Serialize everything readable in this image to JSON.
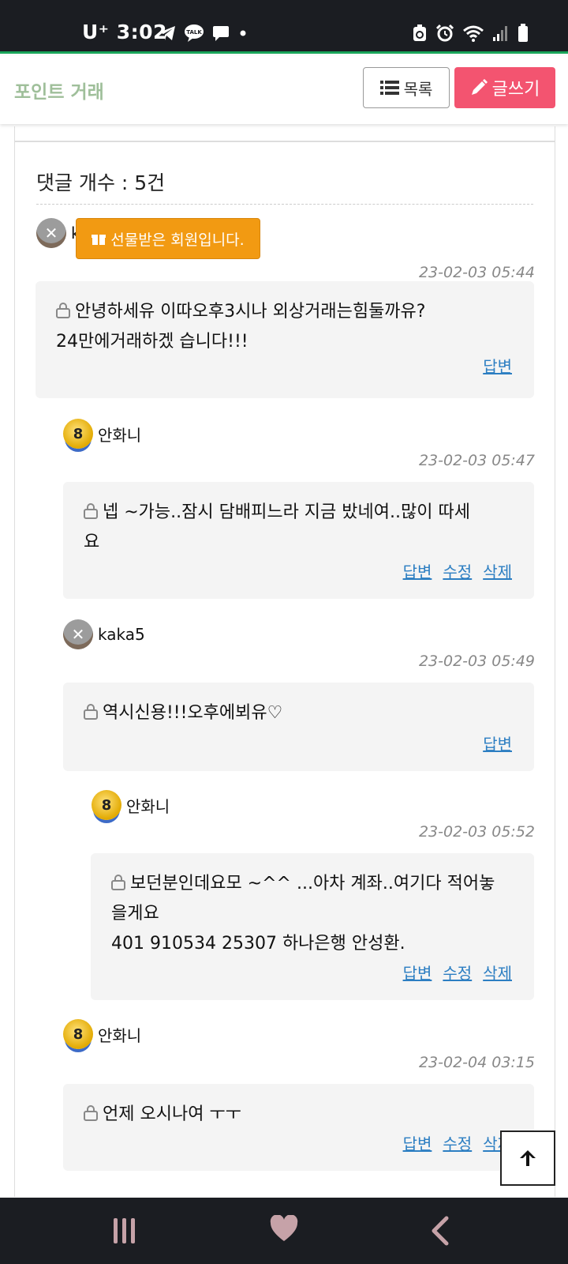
{
  "status_bar": {
    "time": "3:02",
    "carrier": "U⁺",
    "left_icons": [
      "telegram-icon",
      "kakaotalk-icon",
      "message-icon",
      "dot-icon"
    ],
    "right_icons": [
      "recycle-icon",
      "alarm-icon",
      "wifi-icon",
      "signal-icon",
      "battery-icon"
    ]
  },
  "header": {
    "title": "포인트 거래",
    "list_button": "목록",
    "write_button": "글쓰기"
  },
  "comment_count_label": "댓글 개수 : 5건",
  "gift_badge": "선물받은 회원입니다.",
  "comments": [
    {
      "author": "kaka5",
      "avatar": "skull-icon",
      "date": "23-02-03 05:44",
      "lines": [
        "안녕하세유 이따오후3시나 외상거래는힘둘까유?",
        "24만에거래하겠 습니다!!!"
      ],
      "actions": [
        "답변"
      ]
    },
    {
      "author": "안화니",
      "avatar": "medal-8-icon",
      "date": "23-02-03 05:47",
      "lines": [
        "넵  ~가능..잠시 담배피느라 지금 밨네여..많이 따세",
        "요"
      ],
      "actions": [
        "답변",
        "수정",
        "삭제"
      ]
    },
    {
      "author": "kaka5",
      "avatar": "skull-icon",
      "date": "23-02-03 05:49",
      "lines": [
        "역시신용!!!오후에뵈유♡"
      ],
      "actions": [
        "답변"
      ]
    },
    {
      "author": "안화니",
      "avatar": "medal-8-icon",
      "date": "23-02-03 05:52",
      "lines": [
        "보던분인데요모 ~^^  ...아차 계좌..여기다 적어놓",
        "을게요",
        "401 910534 25307  하나은행 안성환."
      ],
      "actions": [
        "답변",
        "수정",
        "삭제"
      ]
    },
    {
      "author": "안화니",
      "avatar": "medal-8-icon",
      "date": "23-02-04 03:15",
      "lines": [
        "언제 오시나여 ㅜㅜ"
      ],
      "actions": [
        "답변",
        "수정",
        "삭제"
      ]
    }
  ],
  "medal_level": "8",
  "nav_bar": [
    "recent-apps-icon",
    "heart-icon",
    "back-icon"
  ],
  "colors": {
    "accent": "#f35470",
    "title_green": "#9fbf9a",
    "gift_orange": "#f29a12",
    "link_blue": "#2c7ec2"
  }
}
